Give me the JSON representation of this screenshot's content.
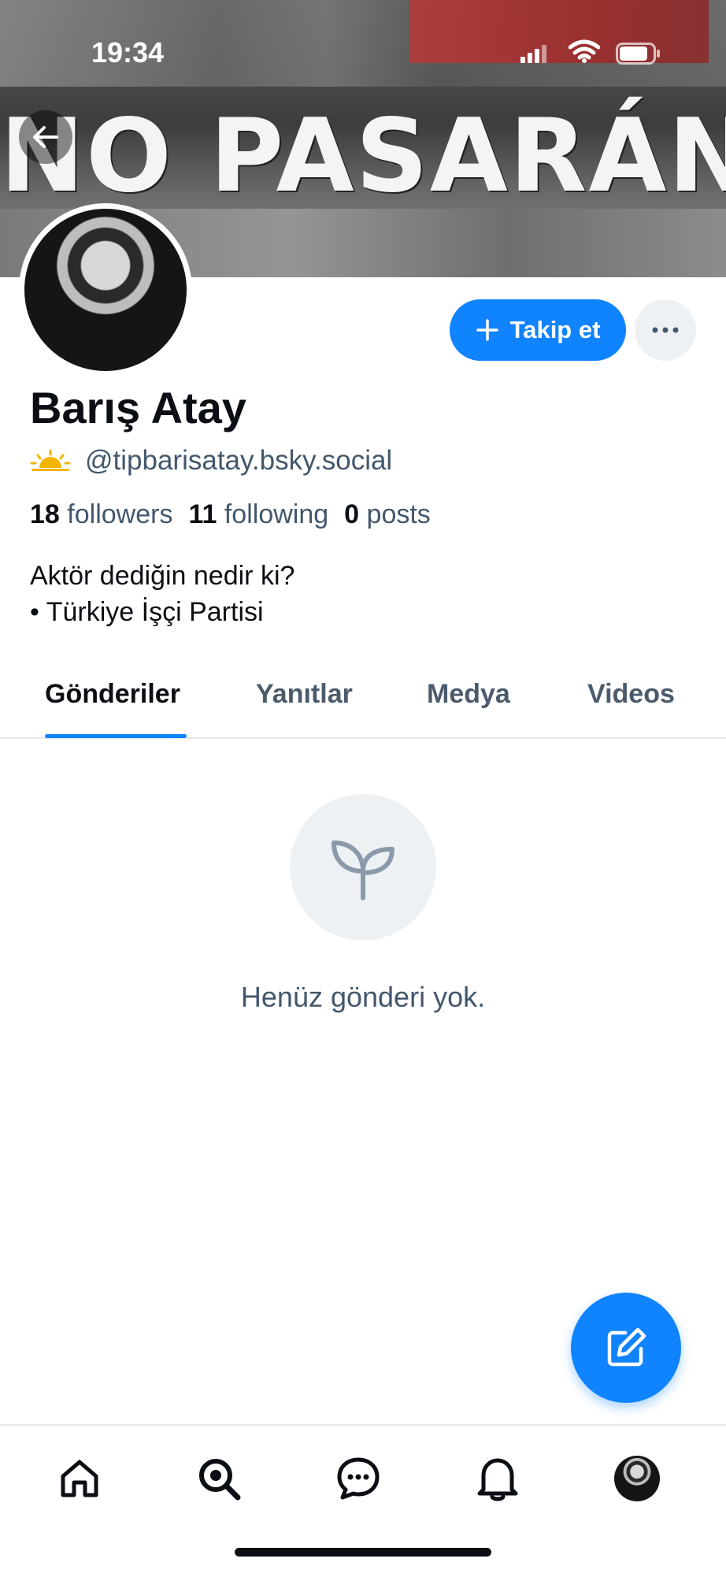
{
  "status_bar": {
    "time": "19:34"
  },
  "banner": {
    "graffiti_text": "NO PASARÁN"
  },
  "profile": {
    "display_name": "Barış Atay",
    "handle": "@tipbarisatay.bsky.social",
    "followers_count": "18",
    "followers_label": "followers",
    "following_count": "11",
    "following_label": "following",
    "posts_count": "0",
    "posts_label": "posts",
    "bio_line1": "Aktör dediğin nedir ki?",
    "bio_line2": "• Türkiye İşçi Partisi"
  },
  "actions": {
    "follow_label": "Takip et"
  },
  "tabs": [
    {
      "label": "Gönderiler",
      "active": true
    },
    {
      "label": "Yanıtlar",
      "active": false
    },
    {
      "label": "Medya",
      "active": false
    },
    {
      "label": "Videos",
      "active": false
    }
  ],
  "empty_state": {
    "message": "Henüz gönderi yok.",
    "icon": "sprout-icon"
  },
  "bottom_nav": {
    "items": [
      "home-icon",
      "search-icon",
      "chat-icon",
      "bell-icon",
      "profile-avatar"
    ]
  },
  "colors": {
    "accent": "#1083fe",
    "muted_text": "#42576c",
    "circle_bg": "#eef1f4"
  }
}
